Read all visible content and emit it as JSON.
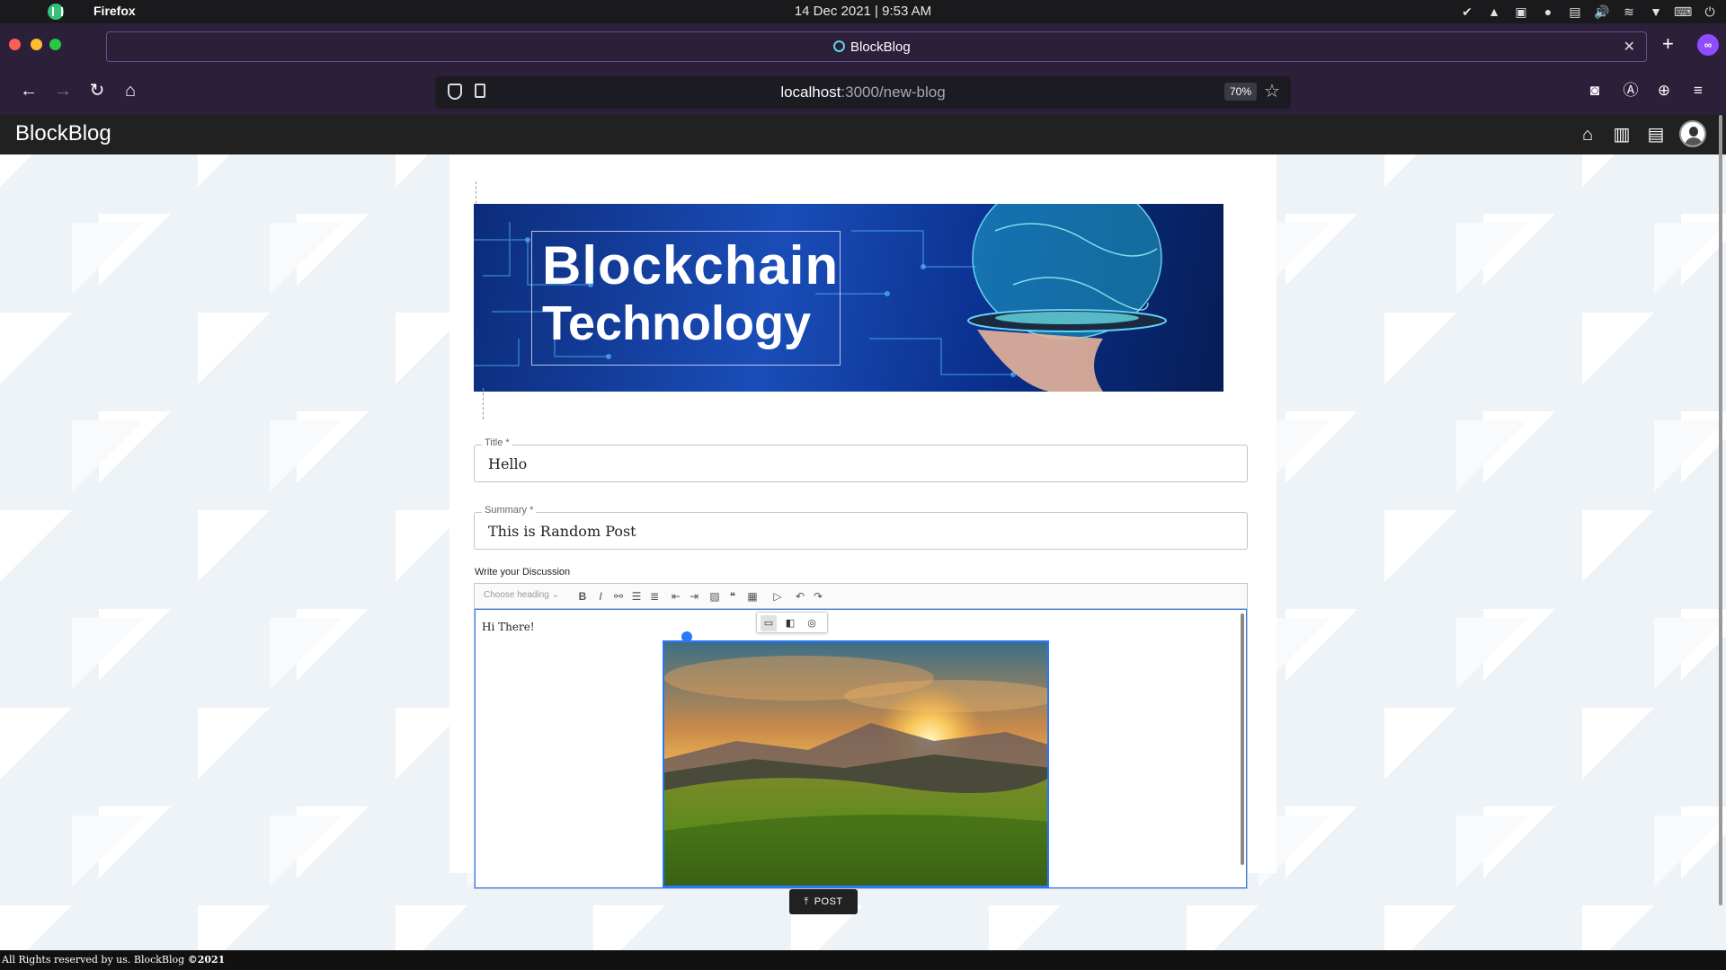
{
  "os": {
    "app_name": "Firefox",
    "clock": "14 Dec 2021 | 9:53 AM",
    "tray_icons": [
      "check-circle-icon",
      "vlc-icon",
      "screenshot-icon",
      "globe-icon",
      "clipboard-icon",
      "volume-icon",
      "wifi-icon",
      "triangle-down-icon",
      "keyboard-icon",
      "power-icon"
    ]
  },
  "browser": {
    "tab_title": "BlockBlog",
    "url_host": "localhost",
    "url_path": ":3000/new-blog",
    "zoom": "70%"
  },
  "app": {
    "title": "BlockBlog",
    "nav_icons": [
      "home-icon",
      "library-icon",
      "chat-icon",
      "avatar"
    ]
  },
  "hero": {
    "line1": "Blockchain",
    "line2": "Technology"
  },
  "form": {
    "title_label": "Title *",
    "title_value": "Hello",
    "summary_label": "Summary *",
    "summary_value": "This is Random Post",
    "discussion_label": "Write your Discussion",
    "heading_select": "Choose heading",
    "editor_text": "Hi There!",
    "post_button": "POST"
  },
  "footer": {
    "text": "All Rights reserved by us. BlockBlog ",
    "copyright": "©2021"
  },
  "colors": {
    "appbar": "#212121",
    "accent": "#2977ff",
    "browser_chrome": "#2b1f3a"
  }
}
